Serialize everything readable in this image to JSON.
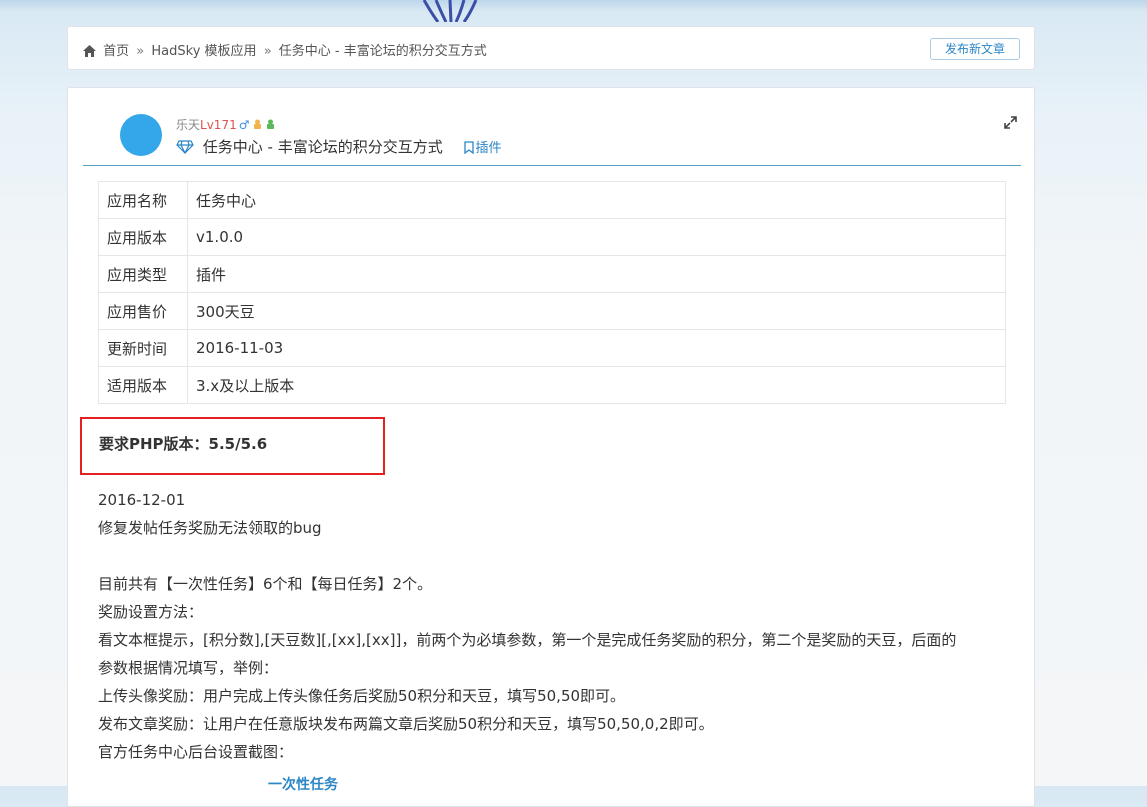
{
  "breadcrumb": {
    "home": "首页",
    "separator": "»",
    "items": [
      "HadSky 模板应用",
      "任务中心 - 丰富论坛的积分交互方式"
    ]
  },
  "publish_button": "发布新文章",
  "post": {
    "username": "乐天",
    "level": "Lv171",
    "gender": "♂",
    "title": "任务中心 - 丰富论坛的积分交互方式",
    "tag": "插件"
  },
  "info_table": [
    {
      "key": "应用名称",
      "value": "任务中心"
    },
    {
      "key": "应用版本",
      "value": "v1.0.0"
    },
    {
      "key": "应用类型",
      "value": "插件"
    },
    {
      "key": "应用售价",
      "value": "300天豆"
    },
    {
      "key": "更新时间",
      "value": "2016-11-03"
    },
    {
      "key": "适用版本",
      "value": "3.x及以上版本"
    }
  ],
  "requirement": "要求PHP版本：5.5/5.6",
  "body": [
    "2016-12-01",
    "修复发帖任务奖励无法领取的bug",
    "",
    "目前共有【一次性任务】6个和【每日任务】2个。",
    "奖励设置方法：",
    "看文本框提示，[积分数],[天豆数][,[xx],[xx]]，前两个为必填参数，第一个是完成任务奖励的积分，第二个是奖励的天豆，后面的",
    "参数根据情况填写，举例：",
    "上传头像奖励：用户完成上传头像任务后奖励50积分和天豆，填写50,50即可。",
    "发布文章奖励：让用户在任意版块发布两篇文章后奖励50积分和天豆，填写50,50,0,2即可。",
    "官方任务中心后台设置截图："
  ],
  "cut_text": "一次性任务",
  "colors": {
    "accent": "#2b86c6",
    "avatar": "#34a6ea",
    "highlight_border": "#e52020",
    "level": "#e35050"
  }
}
